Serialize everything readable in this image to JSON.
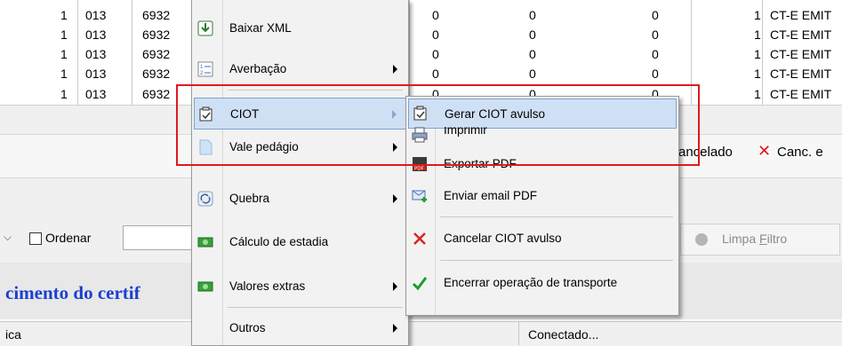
{
  "grid": {
    "rows": [
      {
        "c1": "1",
        "c2": "013",
        "c3": "6932",
        "v1": "0",
        "v2": "0",
        "v3": "0",
        "v4": "1",
        "type": "CT-E EMIT"
      },
      {
        "c1": "1",
        "c2": "013",
        "c3": "6932",
        "v1": "0",
        "v2": "0",
        "v3": "0",
        "v4": "1",
        "type": "CT-E EMIT"
      },
      {
        "c1": "1",
        "c2": "013",
        "c3": "6932",
        "v1": "0",
        "v2": "0",
        "v3": "0",
        "v4": "1",
        "type": "CT-E EMIT"
      },
      {
        "c1": "1",
        "c2": "013",
        "c3": "6932",
        "v1": "0",
        "v2": "0",
        "v3": "0",
        "v4": "1",
        "type": "CT-E EMIT"
      },
      {
        "c1": "1",
        "c2": "013",
        "c3": "6932",
        "v1": "0",
        "v2": "0",
        "v3": "0",
        "v4": "1",
        "type": "CT-E EMIT"
      }
    ]
  },
  "legend": {
    "cancelado": "ancelado",
    "canc_e": "Canc. e"
  },
  "filters": {
    "ordenar_label": "Ordenar",
    "limpa_filtro_pre": "Limpa ",
    "limpa_filtro_u": "F",
    "limpa_filtro_post": "iltro"
  },
  "footer": {
    "heading": "cimento do certif",
    "status_left": "ica",
    "status_right": "Conectado..."
  },
  "context_menu": {
    "items": [
      {
        "label": "Baixar XML",
        "icon": "download-icon"
      },
      {
        "label": "Averbação",
        "icon": "list-icon"
      },
      {
        "label": "CIOT",
        "icon": "checklist-icon"
      },
      {
        "label": "Vale pedágio",
        "icon": "document-icon"
      },
      {
        "label": "Quebra",
        "icon": "refresh-icon"
      },
      {
        "label": "Cálculo de estadia",
        "icon": "money-icon"
      },
      {
        "label": "Valores extras",
        "icon": "money-icon"
      },
      {
        "label": "Outros",
        "icon": ""
      }
    ]
  },
  "submenu": {
    "items": [
      {
        "label": "Gerar CIOT avulso",
        "icon": "checklist-icon"
      },
      {
        "label": "Imprimir",
        "icon": "printer-icon"
      },
      {
        "label": "Exportar PDF",
        "icon": "pdf-icon"
      },
      {
        "label": "Enviar email PDF",
        "icon": "email-icon"
      },
      {
        "label": "Cancelar CIOT avulso",
        "icon": "cancel-x-icon"
      },
      {
        "label": "Encerrar operação de transporte",
        "icon": "checkmark-icon"
      }
    ]
  },
  "colors": {
    "highlight_border": "#e0191e",
    "menu_hover": "#cfe0f5",
    "heading_blue": "#1a3fd0",
    "cancel_red": "#e0191e"
  }
}
